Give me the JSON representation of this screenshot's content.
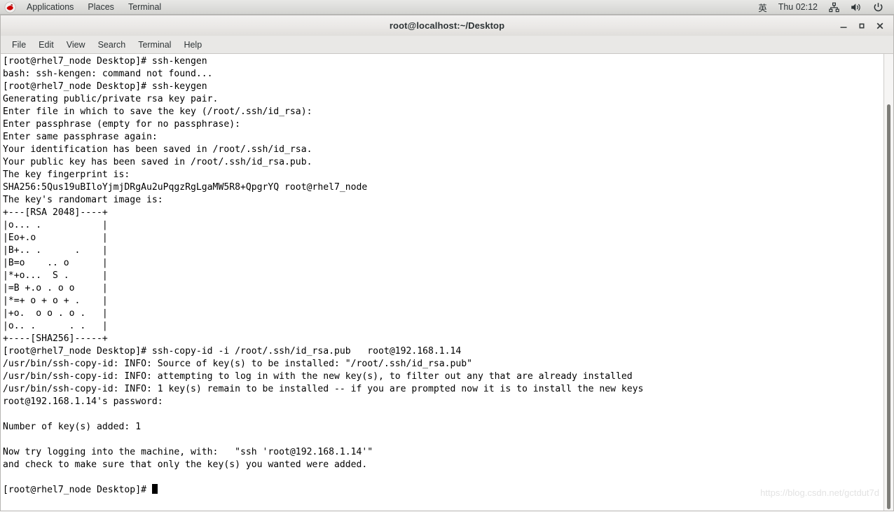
{
  "top_panel": {
    "logo_icon": "red-hat-logo-icon",
    "menus": [
      {
        "label": "Applications",
        "name": "applications-menu"
      },
      {
        "label": "Places",
        "name": "places-menu"
      },
      {
        "label": "Terminal",
        "name": "terminal-menu"
      }
    ],
    "right": {
      "input_method": "英",
      "clock": "Thu 02:12",
      "network_icon": "network-icon",
      "volume_icon": "volume-icon",
      "power_icon": "power-icon"
    }
  },
  "window": {
    "title": "root@localhost:~/Desktop",
    "controls": {
      "minimize": "–",
      "maximize": "□",
      "close": "✕"
    }
  },
  "menubar": {
    "items": [
      {
        "label": "File",
        "name": "menu-file"
      },
      {
        "label": "Edit",
        "name": "menu-edit"
      },
      {
        "label": "View",
        "name": "menu-view"
      },
      {
        "label": "Search",
        "name": "menu-search"
      },
      {
        "label": "Terminal",
        "name": "menu-terminal"
      },
      {
        "label": "Help",
        "name": "menu-help"
      }
    ]
  },
  "terminal": {
    "prompt": "[root@rhel7_node Desktop]# ",
    "lines": [
      "[root@rhel7_node Desktop]# ssh-kengen",
      "bash: ssh-kengen: command not found...",
      "[root@rhel7_node Desktop]# ssh-keygen",
      "Generating public/private rsa key pair.",
      "Enter file in which to save the key (/root/.ssh/id_rsa):",
      "Enter passphrase (empty for no passphrase):",
      "Enter same passphrase again:",
      "Your identification has been saved in /root/.ssh/id_rsa.",
      "Your public key has been saved in /root/.ssh/id_rsa.pub.",
      "The key fingerprint is:",
      "SHA256:5Qus19uBIloYjmjDRgAu2uPqgzRgLgaMW5R8+QpgrYQ root@rhel7_node",
      "The key's randomart image is:",
      "+---[RSA 2048]----+",
      "|o... .           |",
      "|Eo+.o            |",
      "|B+.. .      .    |",
      "|B=o    .. o      |",
      "|*+o...  S .      |",
      "|=B +.o . o o     |",
      "|*=+ o + o + .    |",
      "|+o.  o o . o .   |",
      "|o.. .      . .   |",
      "+----[SHA256]-----+",
      "[root@rhel7_node Desktop]# ssh-copy-id -i /root/.ssh/id_rsa.pub   root@192.168.1.14",
      "/usr/bin/ssh-copy-id: INFO: Source of key(s) to be installed: \"/root/.ssh/id_rsa.pub\"",
      "/usr/bin/ssh-copy-id: INFO: attempting to log in with the new key(s), to filter out any that are already installed",
      "/usr/bin/ssh-copy-id: INFO: 1 key(s) remain to be installed -- if you are prompted now it is to install the new keys",
      "root@192.168.1.14's password:",
      "",
      "Number of key(s) added: 1",
      "",
      "Now try logging into the machine, with:   \"ssh 'root@192.168.1.14'\"",
      "and check to make sure that only the key(s) you wanted were added.",
      ""
    ],
    "cursor_visible": true
  },
  "watermark": "https://blog.csdn.net/gctdut7d",
  "colors": {
    "panel_bg": "#dededc",
    "titlebar_bg": "#eae8e6",
    "menubar_bg": "#e9e8e6",
    "terminal_bg": "#ffffff",
    "terminal_fg": "#000000",
    "accent_logo": "#cc0000"
  }
}
